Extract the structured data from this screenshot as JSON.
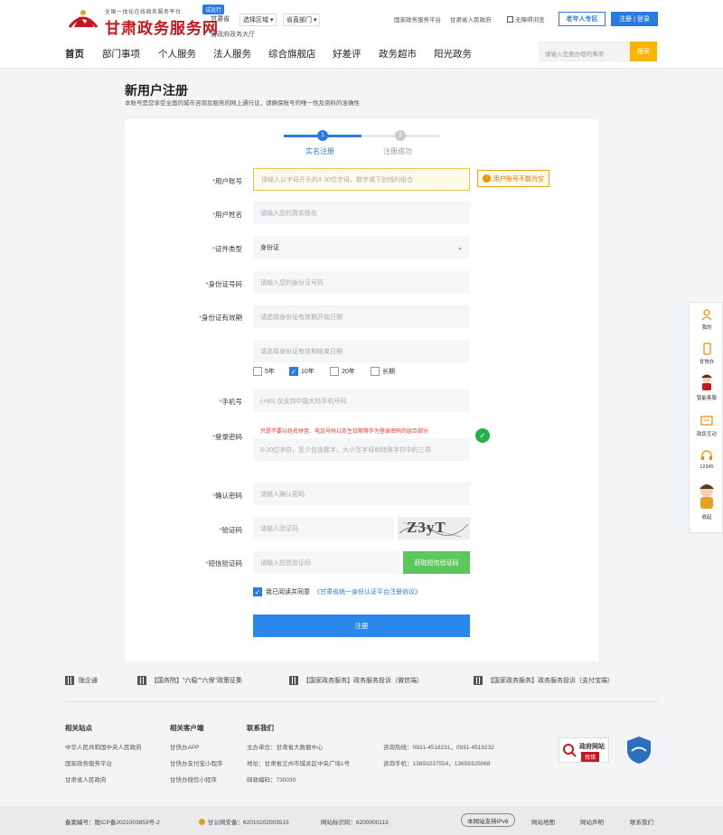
{
  "header": {
    "tagline": "全国一体化在线政务服务平台",
    "site_title": "甘肃政务服务网",
    "beta_badge": "试运行",
    "province": "甘肃省",
    "region_dropdown": "选择区域",
    "dept_dropdown": "省直部门",
    "hall_link": "省政府政务大厅",
    "top_links": [
      "国家政务服务平台",
      "甘肃省人民政府",
      "无障碍浏览"
    ],
    "elder_button": "老年人专区",
    "login_button": "注册 | 登录",
    "nav": [
      "首页",
      "部门事项",
      "个人服务",
      "法人服务",
      "综合旗舰店",
      "好差评",
      "政务超市",
      "阳光政务"
    ],
    "search_placeholder": "请输入您要办理的事项",
    "search_button": "搜索"
  },
  "page": {
    "title": "新用户注册",
    "desc": "本账号是您享受全面的城市咨询及服务的网上通行证，请确保账号的唯一性及资料的准确性"
  },
  "steps": [
    {
      "num": "1",
      "label": "实名注册",
      "active": true
    },
    {
      "num": "2",
      "label": "注册成功",
      "active": false
    }
  ],
  "form": {
    "account_label": "用户账号",
    "account_placeholder": "请输入以字母开头的4-30位字母、数字或下划线的组合",
    "account_error": "用户账号不能为空",
    "name_label": "用户姓名",
    "name_placeholder": "请输入您的真实姓名",
    "idtype_label": "证件类型",
    "idtype_value": "身份证",
    "idnum_label": "身份证号码",
    "idnum_placeholder": "请输入您的身份证号码",
    "valid_label": "身份证有效期",
    "valid_start_placeholder": "请选择身份证有效期开始日期",
    "valid_end_placeholder": "请选择身份证有效期结束日期",
    "valid_options": [
      {
        "label": "5年",
        "checked": false
      },
      {
        "label": "10年",
        "checked": true
      },
      {
        "label": "20年",
        "checked": false
      },
      {
        "label": "长期",
        "checked": false
      }
    ],
    "phone_label": "手机号",
    "phone_placeholder": "(+86) 仅支持中国大陆手机号码",
    "pwd_label": "登录密码",
    "pwd_hint": "只是不要以姓名拼音、电话号码以及生日期等作为登录密码的组合部分",
    "pwd_placeholder": "8-20位字符，至少包含数字、大小写字母和特殊字符中的三项",
    "confirm_label": "确认密码",
    "confirm_placeholder": "请输入确认密码",
    "captcha_label": "验证码",
    "captcha_placeholder": "请输入验证码",
    "captcha_text": "Z3yT",
    "sms_label": "短信验证码",
    "sms_placeholder": "请输入短信验证码",
    "sms_button": "获取短信验证码",
    "agree_text": "我已阅读并同意",
    "agree_link": "《甘肃省统一身份认证平台注册协议》",
    "submit": "注册"
  },
  "sidebar": [
    "我的",
    "甘快办",
    "智能客服",
    "政民互动",
    "12345",
    "收起"
  ],
  "footer": {
    "top_links": [
      "陇企通",
      "【国务院】\"六稳\"\"六保\"政策征集",
      "【国家政务服务】政务服务投诉（微信端）",
      "【国家政务服务】政务服务投诉（支付宝端）"
    ],
    "col1_title": "相关站点",
    "col1": [
      "中华人民共和国中央人民政府",
      "国家政务服务平台",
      "甘肃省人民政府"
    ],
    "col2_title": "相关客户端",
    "col2": [
      "甘快办APP",
      "甘快办支付宝小程序",
      "甘快办微信小程序"
    ],
    "col3_title": "联系我们",
    "col3": [
      "主办单位：甘肃省大数据中心",
      "地址：甘肃省兰州市城关区中央广场1号",
      "邮政编码：730030"
    ],
    "col4": [
      "咨询热线：0931-4518231，0931-4518232",
      "咨询手机：13893237554，13659325068"
    ],
    "badge_title": "政府网站",
    "badge_sub": "找错",
    "bottom": {
      "icp": "备案编号：陇ICP备2021003853号-2",
      "police": "甘公网安备：62010202003515",
      "site_id": "网站标识码：6200000113",
      "ipv6": "本网站支持IPv6",
      "links": [
        "网站地图",
        "网站声明",
        "联系我们"
      ]
    }
  }
}
